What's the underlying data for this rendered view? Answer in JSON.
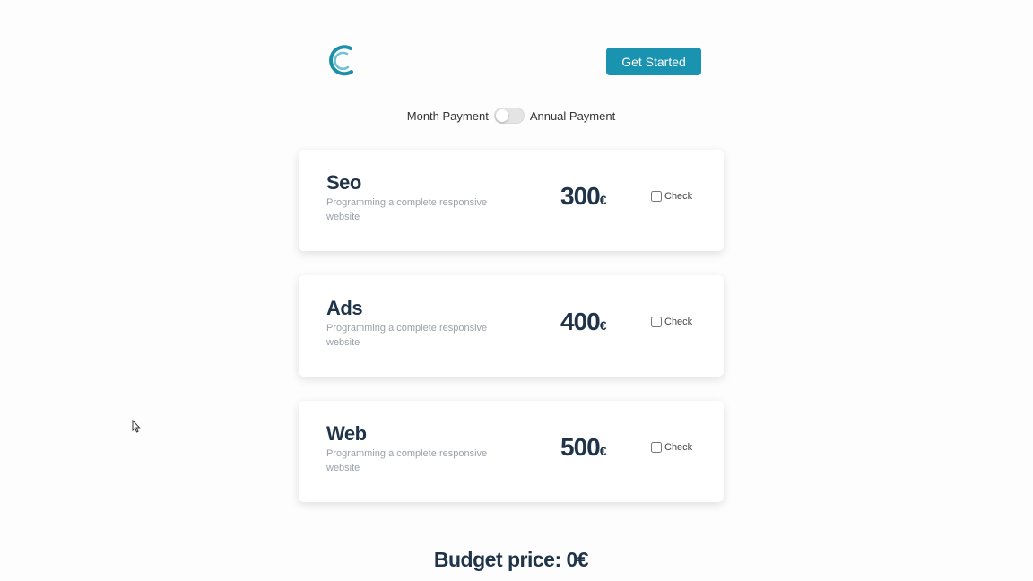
{
  "header": {
    "logo_icon": "c-logo-icon",
    "get_started_label": "Get Started",
    "accent_color": "#1a93b0"
  },
  "billing_toggle": {
    "left_label": "Month Payment",
    "right_label": "Annual Payment",
    "annual_selected": false
  },
  "services": [
    {
      "title": "Seo",
      "description": "Programming a complete responsive website",
      "price": "300",
      "currency": "€",
      "check_label": "Check",
      "checked": false
    },
    {
      "title": "Ads",
      "description": "Programming a complete responsive website",
      "price": "400",
      "currency": "€",
      "check_label": "Check",
      "checked": false
    },
    {
      "title": "Web",
      "description": "Programming a complete responsive website",
      "price": "500",
      "currency": "€",
      "check_label": "Check",
      "checked": false
    }
  ],
  "budget": {
    "text": "Budget price:  0€"
  }
}
